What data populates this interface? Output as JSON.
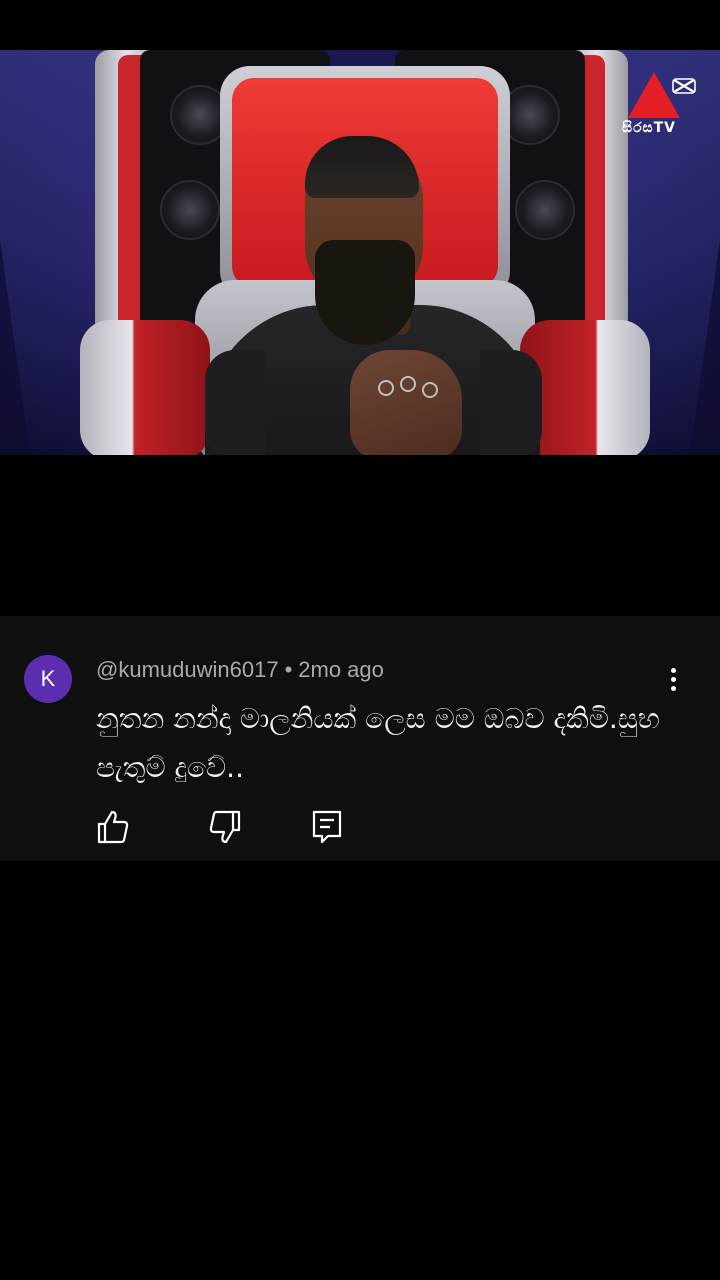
{
  "video": {
    "channel_logo_text": "සිරසTV",
    "channel_logo_color": "#e31e24",
    "overlay_icon": "capcut-icon"
  },
  "comment": {
    "avatar_letter": "K",
    "avatar_color": "#5b2fb0",
    "username": "@kumuduwin6017",
    "separator": "•",
    "time": "2mo ago",
    "text": "නුතන නන්දා මාලනියක් ලෙස මම ඔබව දකිමි.සුභ පැතුම් දුවේ..",
    "actions": [
      "like-icon",
      "dislike-icon",
      "reply-icon"
    ],
    "menu_icon": "more-vert-icon"
  }
}
